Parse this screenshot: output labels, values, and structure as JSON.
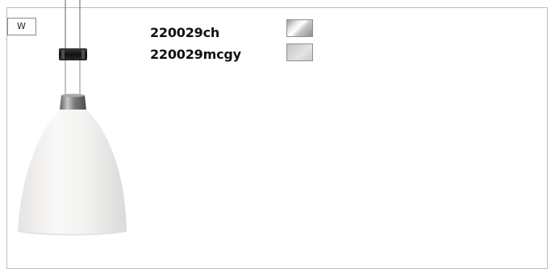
{
  "tag": {
    "label": "W"
  },
  "products": [
    {
      "code": "220029ch",
      "finish_color": "#d6d6d6"
    },
    {
      "code": "220029mcgy",
      "finish_color": "#d3d3d3"
    }
  ],
  "lamp": {
    "icon": "pendant-lamp-icon",
    "shade_color": "#f3f1ef",
    "collar_color": "#8a8a8a",
    "clip_color": "#1e1e1e"
  }
}
